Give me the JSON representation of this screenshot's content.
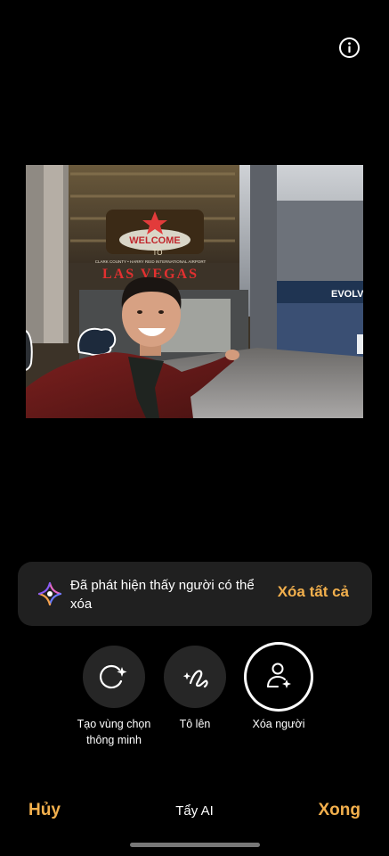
{
  "photo": {
    "sign_line1": "WELCOME",
    "sign_line2": "TO",
    "sign_airport": "CLARK COUNTY • HARRY REID INTERNATIONAL AIRPORT",
    "sign_city": "LAS VEGAS",
    "store_sign": "EVOLVE"
  },
  "banner": {
    "message": "Đã phát hiện thấy người có thể xóa",
    "action": "Xóa tất cả"
  },
  "tools": [
    {
      "label": "Tạo vùng chọn thông minh",
      "icon": "smart-selection-icon"
    },
    {
      "label": "Tô lên",
      "icon": "draw-icon"
    },
    {
      "label": "Xóa người",
      "icon": "remove-person-icon"
    }
  ],
  "bottom": {
    "cancel": "Hủy",
    "title": "Tẩy AI",
    "done": "Xong"
  },
  "colors": {
    "accent": "#f3b04d",
    "banner_bg": "#202020",
    "tool_bg": "#262626"
  }
}
